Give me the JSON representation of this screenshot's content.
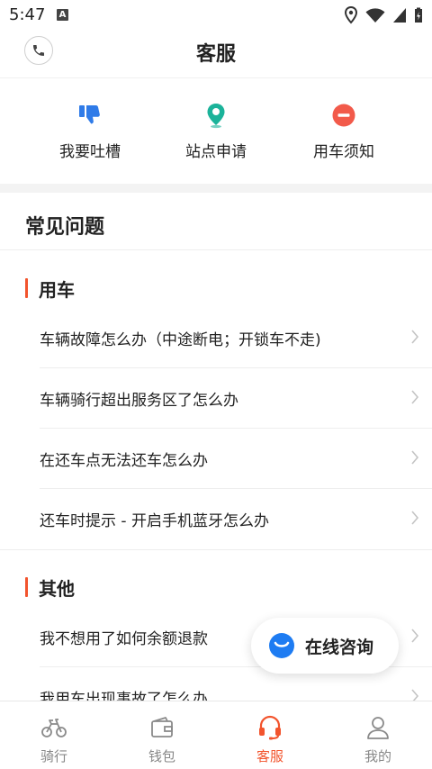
{
  "status": {
    "time": "5:47",
    "a_badge": "A"
  },
  "header": {
    "title": "客服"
  },
  "shortcuts": [
    {
      "label": "我要吐槽",
      "icon": "thumbs-down-icon",
      "color": "#2f7be8"
    },
    {
      "label": "站点申请",
      "icon": "location-pin-icon",
      "color": "#1bb39a"
    },
    {
      "label": "用车须知",
      "icon": "minus-circle-icon",
      "color": "#f25a4a"
    }
  ],
  "faq": {
    "title": "常见问题",
    "sections": [
      {
        "label": "用车",
        "questions": [
          "车辆故障怎么办（中途断电；开锁车不走)",
          "车辆骑行超出服务区了怎么办",
          "在还车点无法还车怎么办",
          "还车时提示 - 开启手机蓝牙怎么办"
        ]
      },
      {
        "label": "其他",
        "questions": [
          "我不想用了如何余额退款",
          "我用车出现事故了怎么办"
        ]
      }
    ]
  },
  "consult": {
    "label": "在线咨询",
    "color": "#1e7cf2"
  },
  "tabbar": {
    "active_color": "#f2542d",
    "tabs": [
      {
        "label": "骑行",
        "icon": "bike-icon"
      },
      {
        "label": "钱包",
        "icon": "wallet-icon"
      },
      {
        "label": "客服",
        "icon": "headset-icon"
      },
      {
        "label": "我的",
        "icon": "user-icon"
      }
    ]
  }
}
